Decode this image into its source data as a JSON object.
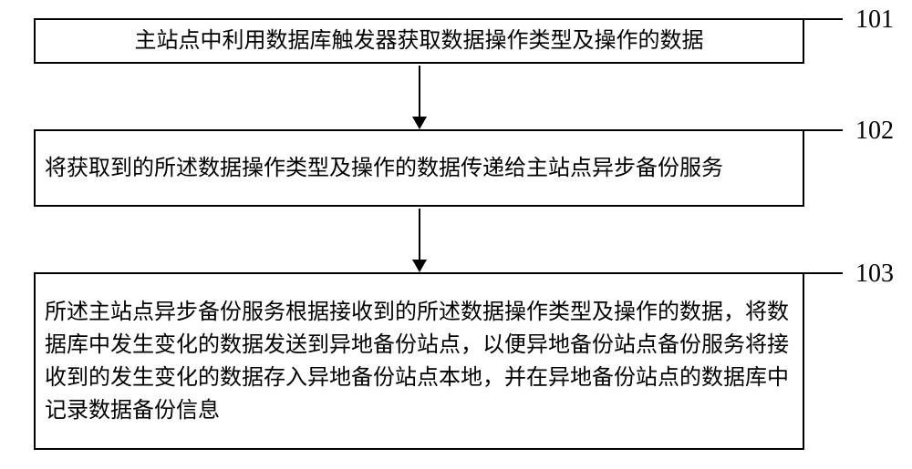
{
  "chart_data": {
    "type": "flowchart",
    "direction": "top-to-bottom",
    "nodes": [
      {
        "id": "101",
        "label_ref": "101",
        "text": "主站点中利用数据库触发器获取数据操作类型及操作的数据"
      },
      {
        "id": "102",
        "label_ref": "102",
        "text": "将获取到的所述数据操作类型及操作的数据传递给主站点异步备份服务"
      },
      {
        "id": "103",
        "label_ref": "103",
        "text": "所述主站点异步备份服务根据接收到的所述数据操作类型及操作的数据，将数据库中发生变化的数据发送到异地备份站点，以便异地备份站点备份服务将接收到的发生变化的数据存入异地备份站点本地，并在异地备份站点的数据库中记录数据备份信息"
      }
    ],
    "edges": [
      {
        "from": "101",
        "to": "102"
      },
      {
        "from": "102",
        "to": "103"
      }
    ]
  },
  "boxes": {
    "b101": {
      "text": "主站点中利用数据库触发器获取数据操作类型及操作的数据"
    },
    "b102": {
      "text": "将获取到的所述数据操作类型及操作的数据传递给主站点异步备份服务"
    },
    "b103": {
      "text": "所述主站点异步备份服务根据接收到的所述数据操作类型及操作的数据，将数据库中发生变化的数据发送到异地备份站点，以便异地备份站点备份服务将接收到的发生变化的数据存入异地备份站点本地，并在异地备份站点的数据库中记录数据备份信息"
    }
  },
  "labels": {
    "l101": "101",
    "l102": "102",
    "l103": "103"
  }
}
